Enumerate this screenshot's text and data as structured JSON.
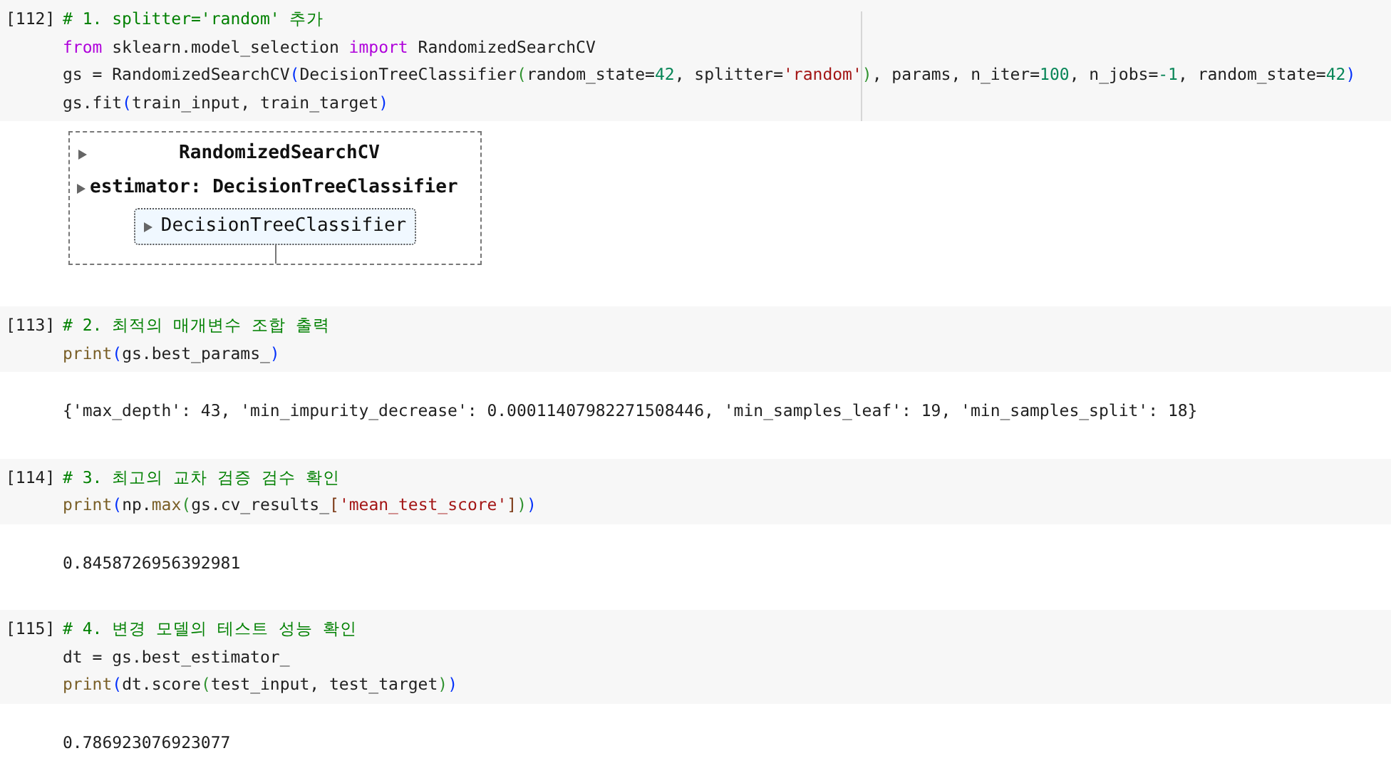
{
  "cells": [
    {
      "prompt": "[112]",
      "lines": [
        [
          {
            "text": "# 1. splitter='random' 추가",
            "kind": "comment"
          }
        ],
        [
          {
            "text": "from",
            "kind": "keyword"
          },
          {
            "text": " sklearn.model_selection ",
            "kind": "plain"
          },
          {
            "text": "import",
            "kind": "keyword"
          },
          {
            "text": " RandomizedSearchCV",
            "kind": "plain"
          }
        ],
        [
          {
            "text": "gs = RandomizedSearchCV",
            "kind": "plain"
          },
          {
            "text": "(",
            "kind": "bracket1"
          },
          {
            "text": "DecisionTreeClassifier",
            "kind": "plain"
          },
          {
            "text": "(",
            "kind": "bracket2"
          },
          {
            "text": "random_state=",
            "kind": "plain"
          },
          {
            "text": "42",
            "kind": "number"
          },
          {
            "text": ", splitter=",
            "kind": "plain"
          },
          {
            "text": "'random'",
            "kind": "string"
          },
          {
            "text": ")",
            "kind": "bracket2"
          },
          {
            "text": ", params, n_iter=",
            "kind": "plain"
          },
          {
            "text": "100",
            "kind": "number"
          },
          {
            "text": ", n_jobs=",
            "kind": "plain"
          },
          {
            "text": "-1",
            "kind": "number"
          },
          {
            "text": ", random_state=",
            "kind": "plain"
          },
          {
            "text": "42",
            "kind": "number"
          },
          {
            "text": ")",
            "kind": "bracket1"
          }
        ],
        [
          {
            "text": "gs.fit",
            "kind": "plain"
          },
          {
            "text": "(",
            "kind": "bracket1"
          },
          {
            "text": "train_input, train_target",
            "kind": "plain"
          },
          {
            "text": ")",
            "kind": "bracket1"
          }
        ]
      ],
      "output": {
        "kind": "widget",
        "title": "RandomizedSearchCV",
        "estimator_label": "estimator: DecisionTreeClassifier",
        "estimator": "DecisionTreeClassifier"
      }
    },
    {
      "prompt": "[113]",
      "lines": [
        [
          {
            "text": "# 2. 최적의 매개변수 조합 출력",
            "kind": "comment"
          }
        ],
        [
          {
            "text": "print",
            "kind": "builtin"
          },
          {
            "text": "(",
            "kind": "bracket1"
          },
          {
            "text": "gs.best_params_",
            "kind": "plain"
          },
          {
            "text": ")",
            "kind": "bracket1"
          }
        ]
      ],
      "output": {
        "kind": "text",
        "text": "{'max_depth': 43, 'min_impurity_decrease': 0.00011407982271508446, 'min_samples_leaf': 19, 'min_samples_split': 18}"
      }
    },
    {
      "prompt": "[114]",
      "lines": [
        [
          {
            "text": "# 3. 최고의 교차 검증 검수 확인",
            "kind": "comment"
          }
        ],
        [
          {
            "text": "print",
            "kind": "builtin"
          },
          {
            "text": "(",
            "kind": "bracket1"
          },
          {
            "text": "np.",
            "kind": "plain"
          },
          {
            "text": "max",
            "kind": "builtin"
          },
          {
            "text": "(",
            "kind": "bracket2"
          },
          {
            "text": "gs.cv_results_",
            "kind": "plain"
          },
          {
            "text": "[",
            "kind": "bracket3"
          },
          {
            "text": "'mean_test_score'",
            "kind": "string"
          },
          {
            "text": "]",
            "kind": "bracket3"
          },
          {
            "text": ")",
            "kind": "bracket2"
          },
          {
            "text": ")",
            "kind": "bracket1"
          }
        ]
      ],
      "output": {
        "kind": "text",
        "text": "0.8458726956392981"
      }
    },
    {
      "prompt": "[115]",
      "lines": [
        [
          {
            "text": "# 4. 변경 모델의 테스트 성능 확인",
            "kind": "comment"
          }
        ],
        [
          {
            "text": "dt = gs.best_estimator_",
            "kind": "plain"
          }
        ],
        [
          {
            "text": "print",
            "kind": "builtin"
          },
          {
            "text": "(",
            "kind": "bracket1"
          },
          {
            "text": "dt.score",
            "kind": "plain"
          },
          {
            "text": "(",
            "kind": "bracket2"
          },
          {
            "text": "test_input, test_target",
            "kind": "plain"
          },
          {
            "text": ")",
            "kind": "bracket2"
          },
          {
            "text": ")",
            "kind": "bracket1"
          }
        ]
      ],
      "output": {
        "kind": "text",
        "text": "0.786923076923077"
      }
    }
  ]
}
